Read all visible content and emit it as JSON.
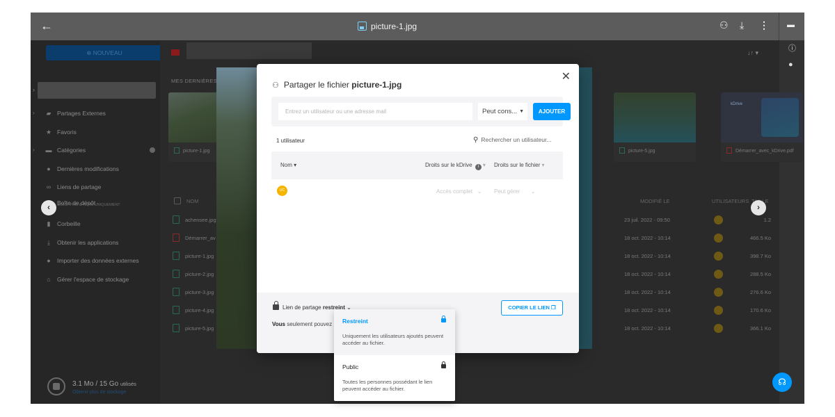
{
  "viewer": {
    "file_name": "picture-1.jpg"
  },
  "sidebar": {
    "new_label": "⊕ NOUVEAU",
    "items": [
      {
        "label": "Partages Externes"
      },
      {
        "label": "Favoris"
      },
      {
        "label": "Catégories"
      },
      {
        "label": "Dernières modifications"
      },
      {
        "label": "Liens de partage"
      },
      {
        "label": "Boîte de dépôt",
        "sub": "SOLO, PRO & TEAM UNIQUEMENT"
      },
      {
        "label": "Corbeille"
      },
      {
        "label": "Obtenir les applications"
      },
      {
        "label": "Importer des données externes"
      },
      {
        "label": "Gérer l'espace de stockage"
      }
    ],
    "storage_used": "3.1 Mo / 15 Go",
    "storage_used_suffix": "utilisés",
    "storage_link": "Obtenir plus de stockage"
  },
  "content": {
    "recent_label": "MES DERNIÈRES",
    "thumbs": [
      {
        "name": "picture-1.jpg"
      },
      {
        "name": "picture-5.jpg"
      },
      {
        "name": "Démarrer_avec_kDrive.pdf"
      }
    ],
    "kdrive_logo": "kDrive",
    "table_headers": {
      "name": "NOM",
      "modified": "MODIFIÉ LE",
      "users": "UTILISATEURS",
      "size": "TAILLE"
    },
    "rows": [
      {
        "name": "achensee.jpg",
        "date": "23 juil. 2022 - 09:50",
        "size": "1.2"
      },
      {
        "name": "Démarrer_av",
        "date": "18 oct. 2022 - 10:14",
        "size": "466.5 Ko"
      },
      {
        "name": "picture-1.jpg",
        "date": "18 oct. 2022 - 10:14",
        "size": "398.7 Ko"
      },
      {
        "name": "picture-2.jpg",
        "date": "18 oct. 2022 - 10:14",
        "size": "288.5 Ko"
      },
      {
        "name": "picture-3.jpg",
        "date": "18 oct. 2022 - 10:14",
        "size": "276.6 Ko"
      },
      {
        "name": "picture-4.jpg",
        "date": "18 oct. 2022 - 10:14",
        "size": "170.6 Ko"
      },
      {
        "name": "picture-5.jpg",
        "date": "18 oct. 2022 - 10:14",
        "size": "366.1 Ko"
      }
    ]
  },
  "modal": {
    "title_prefix": "Partager le fichier",
    "title_file": "picture-1.jpg",
    "invite_placeholder": "Entrez un utilisateur ou une adresse mail",
    "permission_value": "Peut cons...",
    "add_label": "AJOUTER",
    "user_count": "1 utilisateur",
    "search_label": "Rechercher un utilisateur...",
    "col_name": "Nom",
    "col_kdrive_rights": "Droits sur le kDrive",
    "col_file_rights": "Droits sur le fichier",
    "user_initials": "UC",
    "user_kdrive_access": "Accès complet",
    "user_file_access": "Peut gérer",
    "link_label_prefix": "Lien de partage",
    "link_label_state": "restreint",
    "copy_link_label": "COPIER LE LIEN",
    "only_bold": "Vous",
    "only_rest": "seulement pouvez"
  },
  "link_menu": {
    "options": [
      {
        "title": "Restreint",
        "desc": "Uniquement les utilisateurs ajoutés peuvent accéder au fichier."
      },
      {
        "title": "Public",
        "desc": "Toutes les personnes possédant le lien peuvent accéder au fichier."
      }
    ]
  },
  "colors": {
    "accent": "#0098ff",
    "avatar": "#f4b400"
  }
}
